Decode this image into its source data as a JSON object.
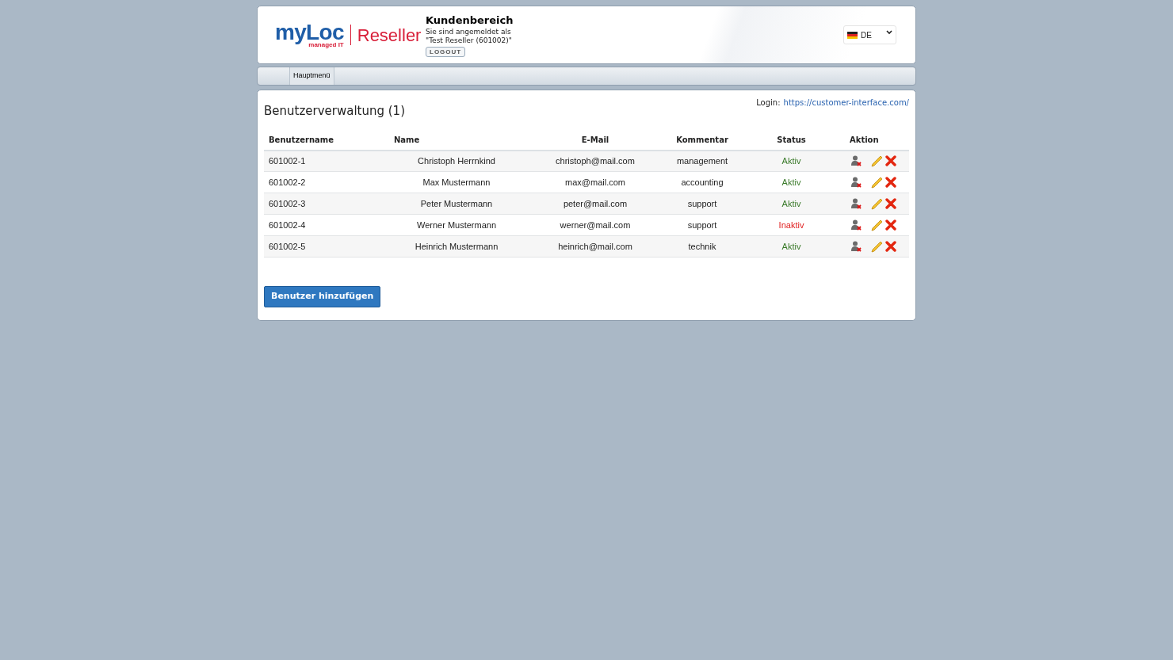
{
  "header": {
    "logo": {
      "brand": "myLoc",
      "tagline": "managed IT",
      "product": "Reseller"
    },
    "title": "Kundenbereich",
    "login_info": [
      "Sie sind angemeldet als",
      "\"Test Reseller (601002)\""
    ],
    "logout": "LOGOUT",
    "language": "DE"
  },
  "nav": [
    {
      "label": "Hauptmenü",
      "selected": true
    }
  ],
  "page": {
    "title": "Benutzerverwaltung (1)",
    "login_label": "Login:",
    "login_url": "https://customer-interface.com/"
  },
  "table": {
    "columns": [
      "Benutzername",
      "Name",
      "E-Mail",
      "Kommentar",
      "Status",
      "Aktion"
    ],
    "rows": [
      {
        "username": "601002-1",
        "name": "Christoph Herrnkind",
        "email": "christoph@mail.com",
        "comment": "management",
        "status": "Aktiv",
        "active": true
      },
      {
        "username": "601002-2",
        "name": "Max Mustermann",
        "email": "max@mail.com",
        "comment": "accounting",
        "status": "Aktiv",
        "active": true
      },
      {
        "username": "601002-3",
        "name": "Peter Mustermann",
        "email": "peter@mail.com",
        "comment": "support",
        "status": "Aktiv",
        "active": true
      },
      {
        "username": "601002-4",
        "name": "Werner Mustermann",
        "email": "werner@mail.com",
        "comment": "support",
        "status": "Inaktiv",
        "active": false
      },
      {
        "username": "601002-5",
        "name": "Heinrich Mustermann",
        "email": "heinrich@mail.com",
        "comment": "technik",
        "status": "Aktiv",
        "active": true
      }
    ]
  },
  "add_button": "Benutzer hinzufügen"
}
